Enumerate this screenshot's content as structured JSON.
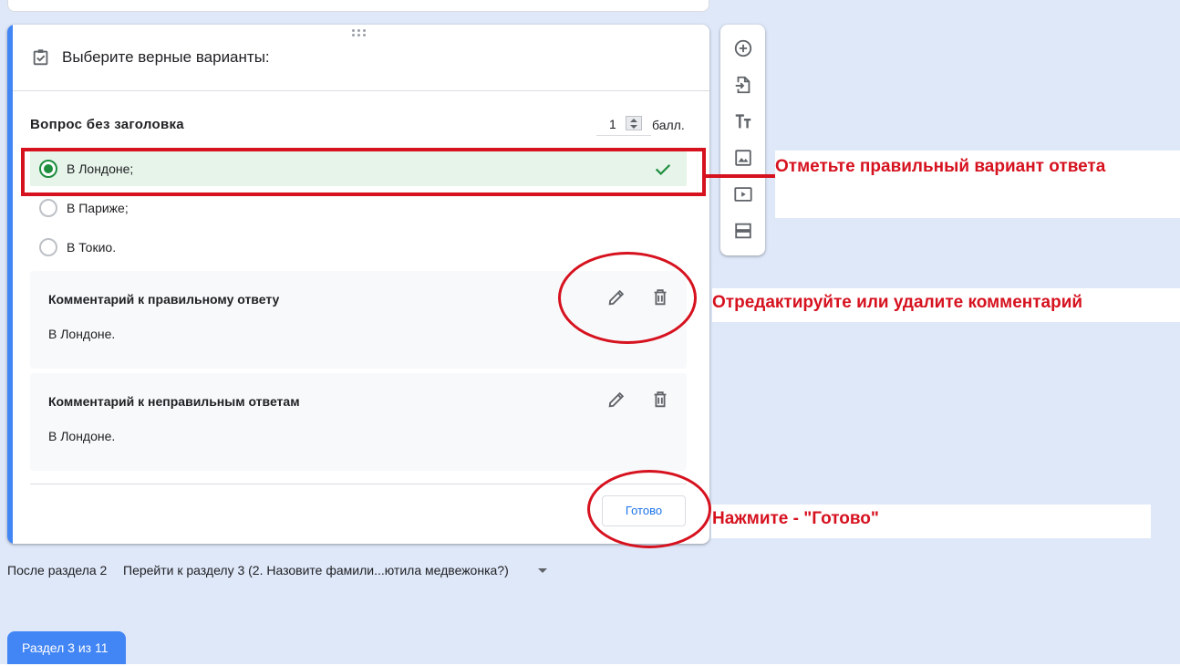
{
  "colors": {
    "accent": "#4285f4",
    "correct": "#1e8e3e",
    "correct_bg": "#e6f4ea",
    "annotation": "#d6121f",
    "page_bg": "#dfe8f9"
  },
  "card": {
    "header_icon": "checkbox-checked-icon",
    "header_title": "Выберите верные варианты:",
    "question_title": "Вопрос без заголовка",
    "points_value": "1",
    "points_label": "балл.",
    "options": [
      {
        "label": "В Лондоне;",
        "correct": true
      },
      {
        "label": "В Париже;",
        "correct": false
      },
      {
        "label": "В Токио.",
        "correct": false
      }
    ],
    "comments": [
      {
        "title": "Комментарий к правильному ответу",
        "text": "В Лондоне."
      },
      {
        "title": "Комментарий к неправильным ответам",
        "text": "В Лондоне."
      }
    ],
    "done_label": "Готово"
  },
  "toolbar": {
    "tools": [
      "add-question-icon",
      "import-questions-icon",
      "add-title-icon",
      "add-image-icon",
      "add-video-icon",
      "add-section-icon"
    ]
  },
  "section_nav": {
    "after_label": "После раздела 2",
    "goto_value": "Перейти к разделу 3 (2. Назовите фамили...ютила медвежонка?)"
  },
  "section_tab": "Раздел 3 из 11",
  "annotations": {
    "correct_answer": "Отметьте правильный вариант ответа",
    "edit_comment": "Отредактируйте или удалите комментарий",
    "press_done": "Нажмите - \"Готово\""
  }
}
